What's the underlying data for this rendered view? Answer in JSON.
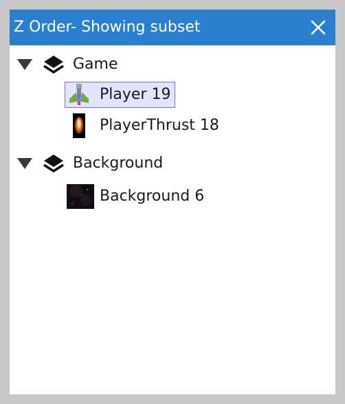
{
  "window": {
    "title": "Z Order- Showing subset"
  },
  "icons": {
    "close": "close-icon",
    "expander": "triangle-down-icon",
    "layer": "layers-icon"
  },
  "tree": {
    "groups": [
      {
        "label": "Game",
        "expanded": true,
        "items": [
          {
            "label": "Player 19",
            "selected": true,
            "thumb": "player-ship-thumbnail"
          },
          {
            "label": "PlayerThrust 18",
            "selected": false,
            "thumb": "thrust-flame-thumbnail"
          }
        ]
      },
      {
        "label": "Background",
        "expanded": true,
        "items": [
          {
            "label": "Background 6",
            "selected": false,
            "thumb": "space-background-thumbnail"
          }
        ]
      }
    ]
  },
  "colors": {
    "titlebar": "#2b7fcf",
    "selection_fill": "#e2e4fb",
    "selection_border": "#6c6fe0",
    "frame": "#c8c8c8"
  }
}
